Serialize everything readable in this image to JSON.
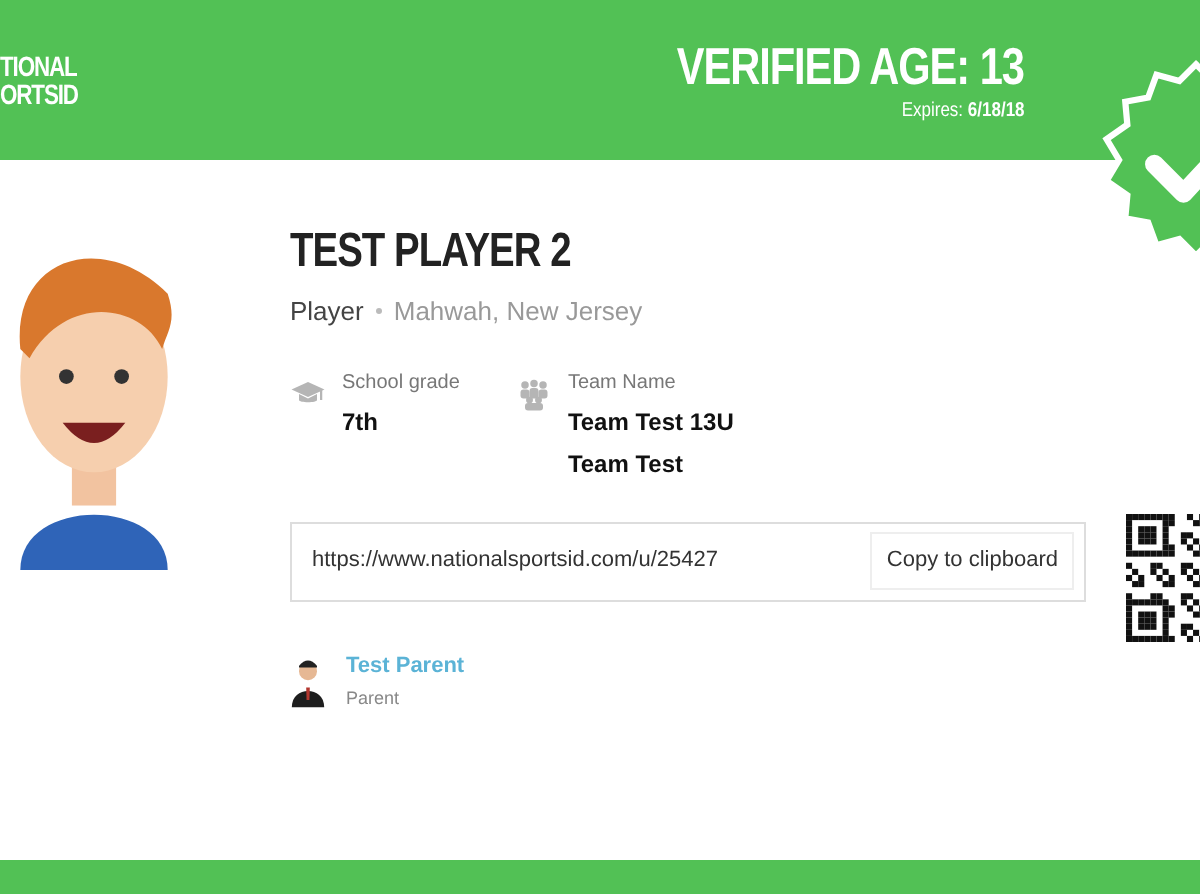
{
  "header": {
    "logo_lines": [
      "TIONAL",
      "ORTSID"
    ],
    "verified": "VERIFIED AGE: 13",
    "expires_label": "Expires:",
    "expires_date": "6/18/18",
    "verified_badge": true
  },
  "player": {
    "name": "TEST PLAYER 2",
    "role": "Player",
    "location": "Mahwah, New Jersey"
  },
  "details": [
    {
      "kind": "grade",
      "label": "School grade",
      "values": [
        "7th"
      ]
    },
    {
      "kind": "team",
      "label": "Team Name",
      "values": [
        "Team Test 13U",
        "Team Test"
      ]
    }
  ],
  "profile_link": {
    "value": "https://www.nationalsportsid.com/u/25427",
    "button": "Copy to clipboard"
  },
  "guardian": {
    "name": "Test Parent",
    "relation": "Parent"
  }
}
